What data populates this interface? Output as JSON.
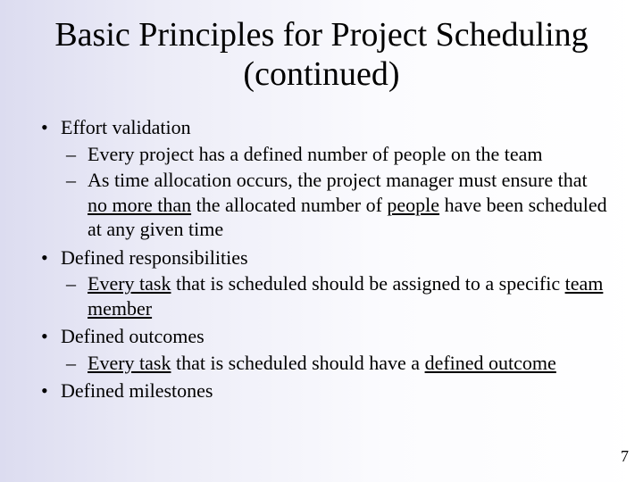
{
  "title": "Basic Principles for Project Scheduling (continued)",
  "bullets": {
    "b0": "Effort validation",
    "b0s0": "Every project has a defined number of people on the team",
    "b0s1_pre": "As time allocation occurs, the project manager must ensure that ",
    "b0s1_u1": "no more than",
    "b0s1_mid": " the allocated number of ",
    "b0s1_u2": "people",
    "b0s1_post": " have been scheduled at any given time",
    "b1": "Defined responsibilities",
    "b1s0_u1": "Every task",
    "b1s0_mid": " that is scheduled should be assigned to a specific ",
    "b1s0_u2": "team member",
    "b2": "Defined outcomes",
    "b2s0_u1": "Every task",
    "b2s0_mid": " that is scheduled should have a ",
    "b2s0_u2": "defined outcome",
    "b3": "Defined milestones"
  },
  "page_number": "7"
}
